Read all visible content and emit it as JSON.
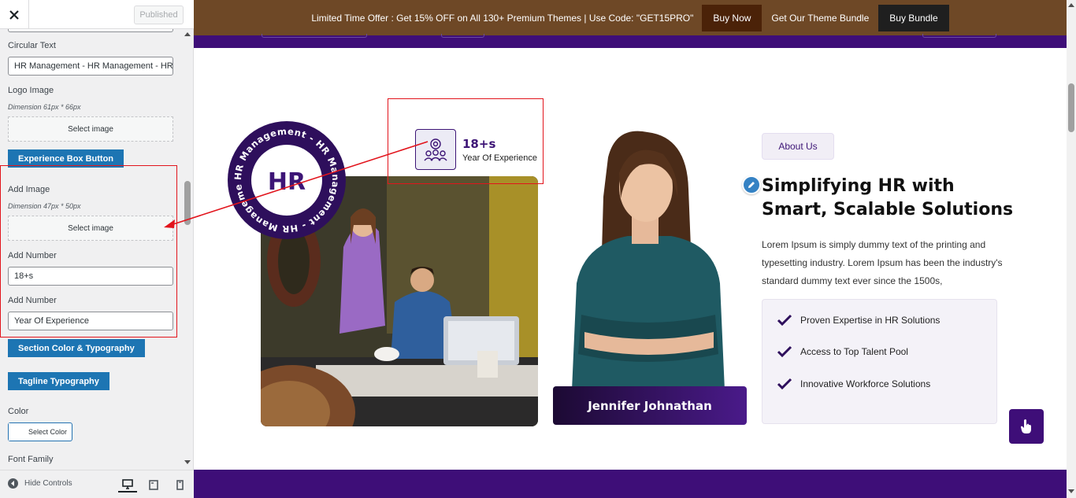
{
  "sidebar": {
    "publish_label": "Published",
    "controls": {
      "circular_text_label": "Circular Text",
      "circular_text_value": "HR Management - HR Management - HR Management",
      "logo_image_label": "Logo Image",
      "logo_image_dimension": "Dimension 61px * 66px",
      "select_image_label": "Select image",
      "experience_button": "Experience Box Button",
      "add_image_label": "Add Image",
      "add_image_dimension": "Dimension 47px * 50px",
      "add_number_label": "Add Number",
      "add_number_value": "18+s",
      "add_number2_label": "Add Number",
      "add_number2_value": "Year Of Experience",
      "section_color_button": "Section Color & Typography",
      "tagline_button": "Tagline Typography",
      "color_label": "Color",
      "select_color_label": "Select Color",
      "font_family_label": "Font Family"
    },
    "footer": {
      "hide_controls": "Hide Controls"
    }
  },
  "preview": {
    "promo": {
      "text": "Limited Time Offer : Get 15% OFF on All 130+ Premium Themes | Use Code: \"GET15PRO\"",
      "buy_now": "Buy Now",
      "bundle_text": "Get Our Theme Bundle",
      "buy_bundle": "Buy Bundle"
    },
    "badge": {
      "logo_text": "HR",
      "circular_text": "HR Management - HR Management - HR Management -"
    },
    "experience": {
      "number": "18+s",
      "label": "Year Of Experience"
    },
    "person_name": "Jennifer Johnathan",
    "about": {
      "tag": "About Us",
      "heading_line1": "Simplifying HR with",
      "heading_line2": "Smart, Scalable Solutions",
      "paragraph": "Lorem Ipsum is simply dummy text of the printing and typesetting industry. Lorem Ipsum has been the industry's standard dummy text ever since the 1500s,",
      "features": [
        "Proven Expertise in HR Solutions",
        "Access to Top Talent Pool",
        "Innovative Workforce Solutions"
      ]
    }
  },
  "colors": {
    "brand_purple": "#3e0e78",
    "promo_brown": "#6e4826",
    "customizer_blue": "#1d75b3",
    "annotation_red": "#e2141c"
  },
  "icons": {
    "close": "close-icon",
    "experience": "team-award-icon",
    "edit": "pencil-icon",
    "feature": "checkmark-icon",
    "floating": "hand-pointer-icon"
  }
}
